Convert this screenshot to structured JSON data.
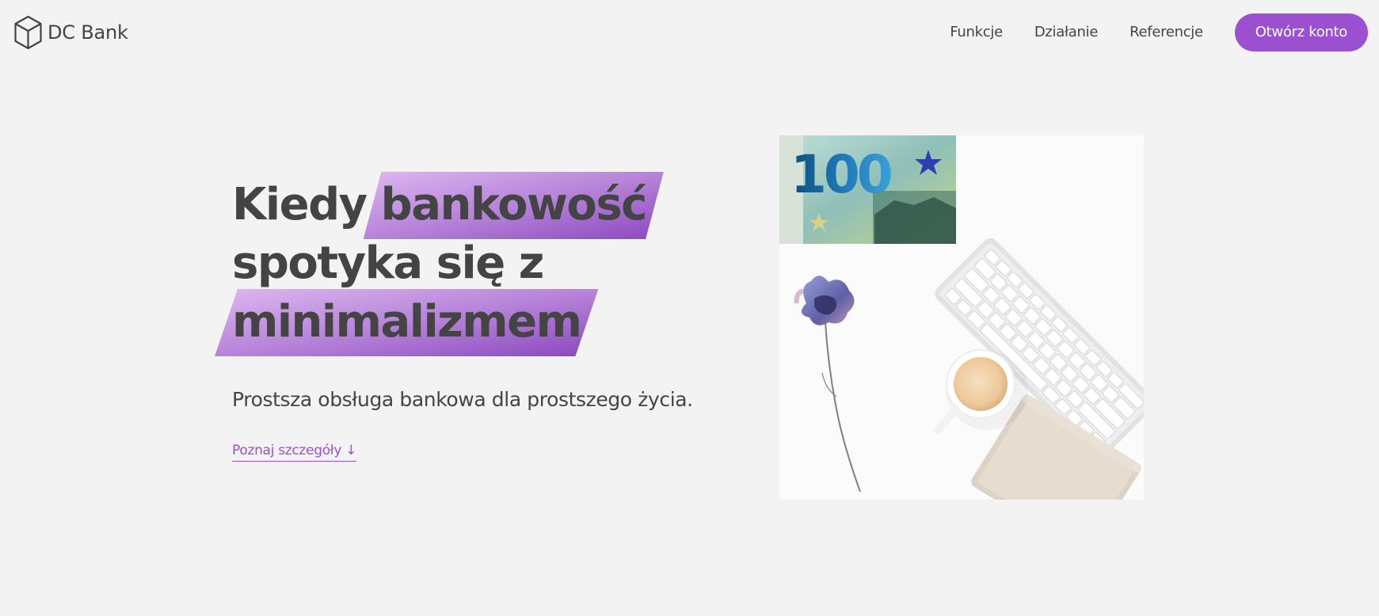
{
  "header": {
    "brand_name": "DC Bank",
    "logo_icon": "cube-icon",
    "nav": [
      {
        "label": "Funkcje"
      },
      {
        "label": "Działanie"
      },
      {
        "label": "Referencje"
      }
    ],
    "cta_label": "Otwórz konto"
  },
  "hero": {
    "title_part1": "Kiedy",
    "title_highlight1": "bankowość",
    "title_part2": "spotyka się z",
    "title_highlight2": "minimalizmem",
    "subtitle": "Prostsza obsługa bankowa dla prostszego życia.",
    "details_link": "Poznaj szczegóły ↓",
    "banknote_denomination": "100",
    "image_subject": "banknote-keyboard-coffee-flower-image"
  },
  "colors": {
    "background": "#f3f3f3",
    "text": "#444444",
    "accent": "#9b51cf",
    "highlight_light": "#dcb7f0",
    "highlight_dark": "#8b48bf"
  }
}
